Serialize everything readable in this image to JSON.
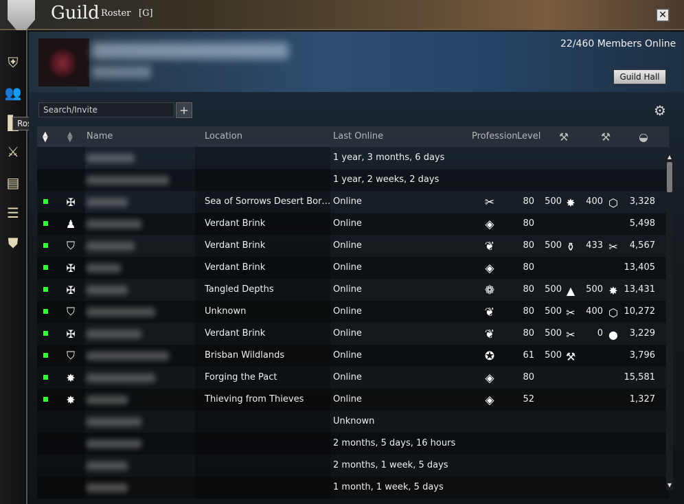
{
  "window": {
    "title": "Guild",
    "section": "Roster",
    "tag": "[G]",
    "close_label": "✕"
  },
  "rail": {
    "tooltip": "Roster",
    "items": [
      {
        "name": "emblem",
        "icon": "shield-emblem-icon",
        "glyph": "⛨"
      },
      {
        "name": "roster",
        "icon": "people-icon",
        "glyph": "👥"
      },
      {
        "name": "ranks",
        "icon": "ranks-icon",
        "glyph": "▙"
      },
      {
        "name": "missions",
        "icon": "crossed-swords-icon",
        "glyph": "⚔"
      },
      {
        "name": "treasury",
        "icon": "chest-icon",
        "glyph": "▤"
      },
      {
        "name": "log",
        "icon": "list-icon",
        "glyph": "☰"
      },
      {
        "name": "upgrades",
        "icon": "shield-icon",
        "glyph": "⛊"
      }
    ]
  },
  "summary": {
    "members_online": "22/460 Members Online",
    "guild_hall_label": "Guild Hall"
  },
  "search": {
    "placeholder": "Search/Invite",
    "add_label": "+",
    "settings_glyph": "⚙"
  },
  "table": {
    "headers": {
      "name": "Name",
      "location": "Location",
      "last_online": "Last Online",
      "profession": "Profession",
      "level": "Level"
    },
    "header_icons": [
      "hammer-icon",
      "hammer-icon",
      "achievement-icon"
    ],
    "rows": [
      {
        "online": false,
        "rank": "",
        "location": "",
        "last": "1 year, 3 months, 6 days",
        "prof": "",
        "level": "",
        "c1": "",
        "c1icon": "",
        "c2": "",
        "c2icon": "",
        "ach": "",
        "nw": 70
      },
      {
        "online": false,
        "rank": "",
        "location": "",
        "last": "1 year, 2 weeks, 2 days",
        "prof": "",
        "level": "",
        "c1": "",
        "c1icon": "",
        "c2": "",
        "c2icon": "",
        "ach": "",
        "nw": 120
      },
      {
        "online": true,
        "rank": "✠",
        "location": "Sea of Sorrows Desert Bord ...",
        "last": "Online",
        "prof": "✂",
        "level": "80",
        "c1": "500",
        "c1icon": "✸",
        "c2": "400",
        "c2icon": "⬡",
        "ach": "3,328",
        "nw": 60
      },
      {
        "online": true,
        "rank": "♟",
        "location": "Verdant Brink",
        "last": "Online",
        "prof": "◈",
        "level": "80",
        "c1": "",
        "c1icon": "",
        "c2": "",
        "c2icon": "",
        "ach": "5,498",
        "nw": 80
      },
      {
        "online": true,
        "rank": "⛉",
        "location": "Verdant Brink",
        "last": "Online",
        "prof": "❦",
        "level": "80",
        "c1": "500",
        "c1icon": "⚱",
        "c2": "433",
        "c2icon": "✂",
        "ach": "4,567",
        "nw": 70
      },
      {
        "online": true,
        "rank": "✠",
        "location": "Verdant Brink",
        "last": "Online",
        "prof": "◈",
        "level": "80",
        "c1": "",
        "c1icon": "",
        "c2": "",
        "c2icon": "",
        "ach": "13,405",
        "nw": 50
      },
      {
        "online": true,
        "rank": "✠",
        "location": "Tangled Depths",
        "last": "Online",
        "prof": "❁",
        "level": "80",
        "c1": "500",
        "c1icon": "▲",
        "c2": "500",
        "c2icon": "✸",
        "ach": "13,431",
        "nw": 60
      },
      {
        "online": true,
        "rank": "⛉",
        "location": "Unknown",
        "last": "Online",
        "prof": "❦",
        "level": "80",
        "c1": "500",
        "c1icon": "✂",
        "c2": "400",
        "c2icon": "⬡",
        "ach": "10,272",
        "nw": 100
      },
      {
        "online": true,
        "rank": "✠",
        "location": "Verdant Brink",
        "last": "Online",
        "prof": "❦",
        "level": "80",
        "c1": "500",
        "c1icon": "✂",
        "c2": "0",
        "c2icon": "●",
        "ach": "3,229",
        "nw": 80
      },
      {
        "online": true,
        "rank": "⛉",
        "location": "Brisban Wildlands",
        "last": "Online",
        "prof": "✪",
        "level": "61",
        "c1": "500",
        "c1icon": "⚒",
        "c2": "",
        "c2icon": "",
        "ach": "3,796",
        "nw": 120
      },
      {
        "online": true,
        "rank": "✸",
        "location": "Forging the Pact",
        "last": "Online",
        "prof": "◈",
        "level": "80",
        "c1": "",
        "c1icon": "",
        "c2": "",
        "c2icon": "",
        "ach": "15,581",
        "nw": 100
      },
      {
        "online": true,
        "rank": "✸",
        "location": "Thieving from Thieves",
        "last": "Online",
        "prof": "◈",
        "level": "52",
        "c1": "",
        "c1icon": "",
        "c2": "",
        "c2icon": "",
        "ach": "1,327",
        "nw": 60
      },
      {
        "online": false,
        "rank": "",
        "location": "",
        "last": "Unknown",
        "prof": "",
        "level": "",
        "c1": "",
        "c1icon": "",
        "c2": "",
        "c2icon": "",
        "ach": "",
        "nw": 80
      },
      {
        "online": false,
        "rank": "",
        "location": "",
        "last": "2 months, 5 days, 16 hours",
        "prof": "",
        "level": "",
        "c1": "",
        "c1icon": "",
        "c2": "",
        "c2icon": "",
        "ach": "",
        "nw": 80
      },
      {
        "online": false,
        "rank": "",
        "location": "",
        "last": "2 months, 1 week, 5 days",
        "prof": "",
        "level": "",
        "c1": "",
        "c1icon": "",
        "c2": "",
        "c2icon": "",
        "ach": "",
        "nw": 60
      },
      {
        "online": false,
        "rank": "",
        "location": "",
        "last": "1 month, 1 week, 5 days",
        "prof": "",
        "level": "",
        "c1": "",
        "c1icon": "",
        "c2": "",
        "c2icon": "",
        "ach": "",
        "nw": 60
      }
    ]
  },
  "colors": {
    "online_dot": "#33ff33",
    "panel_blue": "#2d4c6e"
  }
}
